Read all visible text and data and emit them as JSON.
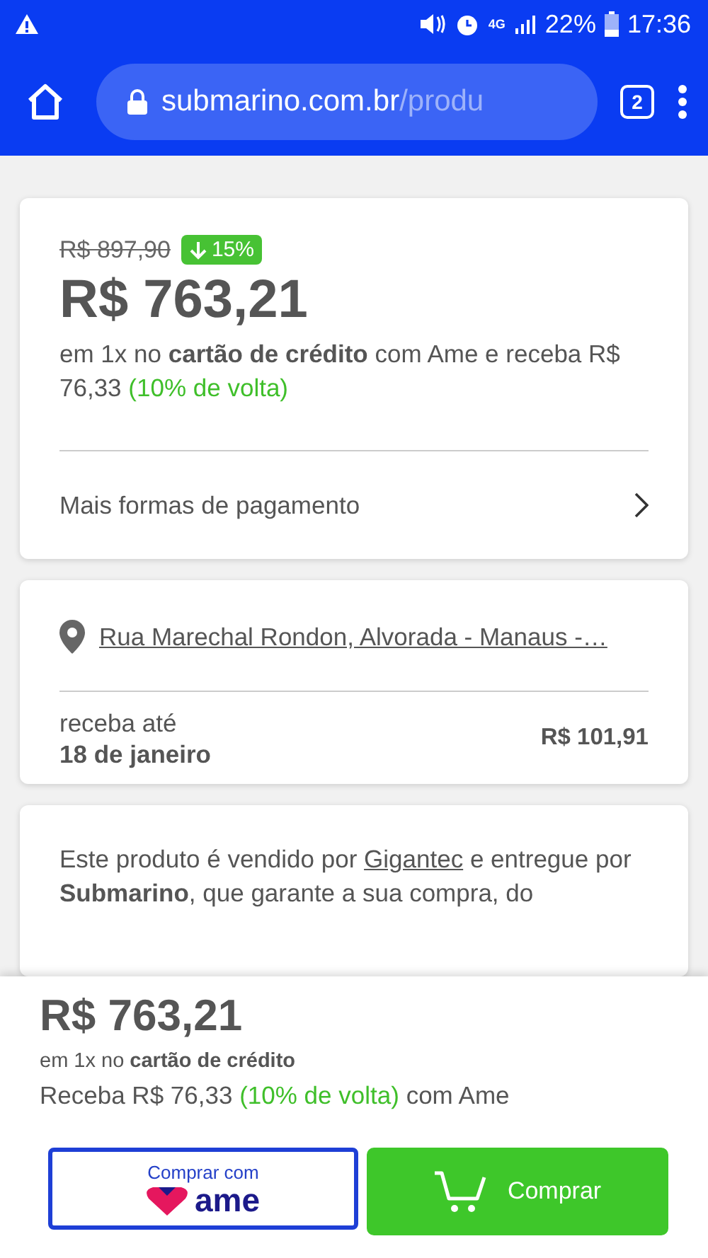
{
  "status_bar": {
    "network": "4G",
    "battery": "22%",
    "time": "17:36"
  },
  "browser": {
    "url_host": "submarino.com.br",
    "url_path": "/produ",
    "tab_count": "2"
  },
  "price_card": {
    "old_price": "R$ 897,90",
    "discount": "15%",
    "price": "R$ 763,21",
    "terms": "em 1x no **cartão de crédito** com Ame e receba R$ 76,33",
    "cashback": "(10% de volta)",
    "more_payments": "Mais formas de pagamento"
  },
  "delivery_card": {
    "address": "Rua Marechal Rondon, Alvorada - Manaus -…",
    "receive_label": "receba até",
    "receive_date": "18 de janeiro",
    "shipping_price": "R$ 101,91"
  },
  "seller_card": {
    "before": "Este produto é vendido por",
    "seller": "Gigantec",
    "after": "e entregue por **Submarino**, que garante a sua compra, do"
  },
  "buy_bar": {
    "price": "R$ 763,21",
    "terms": "em 1x no **cartão de crédito**",
    "cashback_before": "Receba R$ 76,33",
    "cashback": "(10% de volta)",
    "cashback_after": "com Ame",
    "ame_button": {
      "label": "Comprar com",
      "logo": "ame"
    },
    "buy_button": "Comprar"
  }
}
